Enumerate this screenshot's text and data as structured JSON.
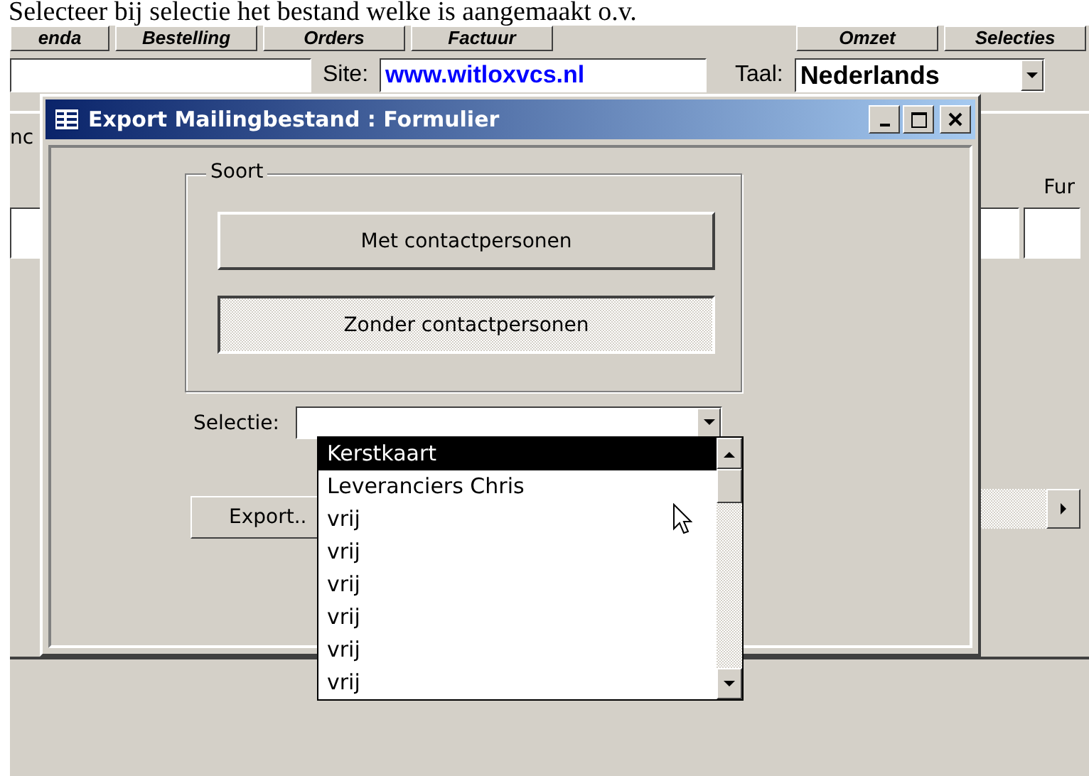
{
  "header_text": "Selecteer bij selectie het bestand welke is aangemaakt o.v.",
  "toolbar": {
    "left": [
      "enda",
      "Bestelling",
      "Orders",
      "Factuur"
    ],
    "right": [
      "Omzet",
      "Selecties"
    ]
  },
  "fields": {
    "site_label": "Site:",
    "site_value": "www.witloxvcs.nl",
    "language_label": "Taal:",
    "language_value": "Nederlands"
  },
  "background": {
    "tab_label": "nc",
    "column_label": "Fur"
  },
  "dialog": {
    "title": "Export Mailingbestand : Formulier",
    "group_label": "Soort",
    "options": [
      {
        "label": "Met contactpersonen",
        "selected": false
      },
      {
        "label": "Zonder contactpersonen",
        "selected": true
      }
    ],
    "selection_label": "Selectie:",
    "export_button": "Export..",
    "dropdown_items": [
      {
        "label": "Kerstkaart",
        "selected": true
      },
      {
        "label": "Leveranciers Chris",
        "selected": false
      },
      {
        "label": "vrij",
        "selected": false
      },
      {
        "label": "vrij",
        "selected": false
      },
      {
        "label": "vrij",
        "selected": false
      },
      {
        "label": "vrij",
        "selected": false
      },
      {
        "label": "vrij",
        "selected": false
      },
      {
        "label": "vrij",
        "selected": false
      }
    ]
  }
}
